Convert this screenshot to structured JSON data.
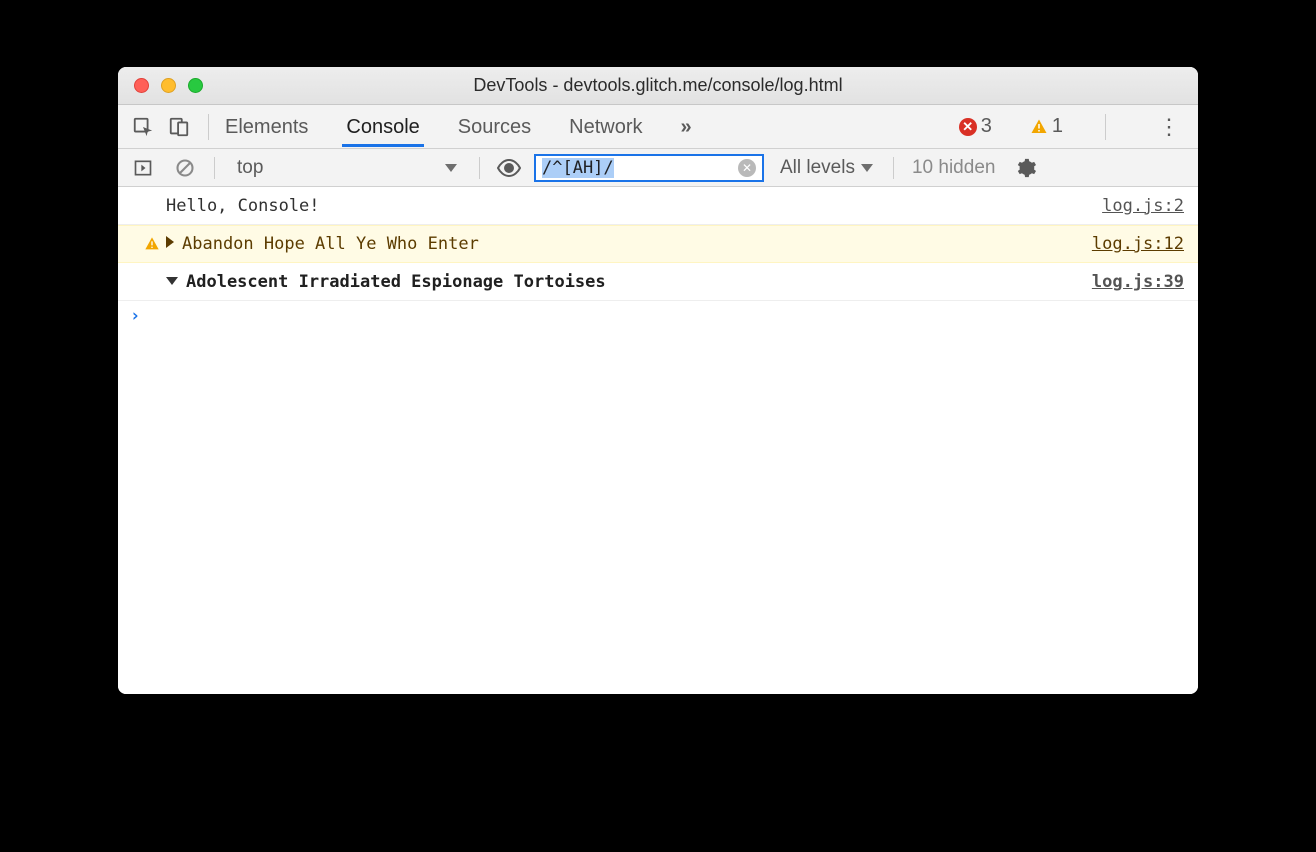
{
  "window": {
    "title": "DevTools - devtools.glitch.me/console/log.html"
  },
  "tabs": {
    "elements": "Elements",
    "console": "Console",
    "sources": "Sources",
    "network": "Network",
    "overflow": "»"
  },
  "badges": {
    "errors": "3",
    "warnings": "1"
  },
  "consoleBar": {
    "context": "top",
    "filter": "/^[AH]/",
    "levels": "All levels",
    "hidden": "10 hidden"
  },
  "messages": [
    {
      "type": "log",
      "text": "Hello, Console!",
      "source": "log.js:2"
    },
    {
      "type": "warn",
      "text": "Abandon Hope All Ye Who Enter",
      "source": "log.js:12"
    },
    {
      "type": "group",
      "text": "Adolescent Irradiated Espionage Tortoises",
      "source": "log.js:39"
    }
  ]
}
